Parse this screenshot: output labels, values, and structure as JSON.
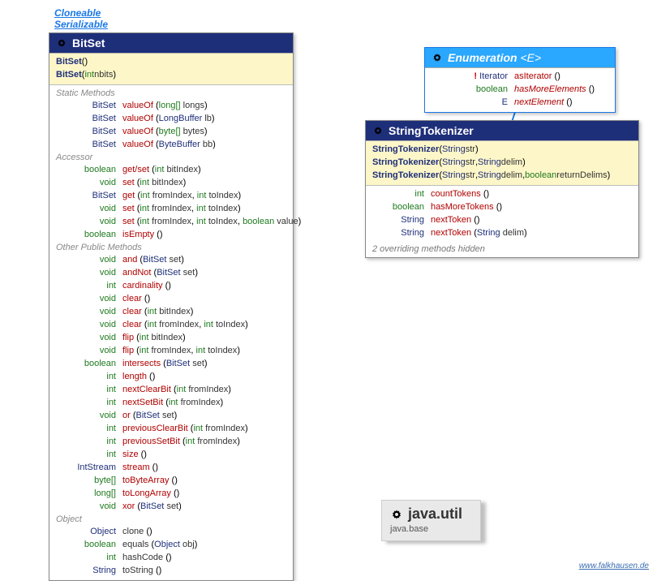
{
  "supertypes": {
    "cloneable": "Cloneable",
    "serializable": "Serializable"
  },
  "bitset": {
    "title": "BitSet",
    "constructors": [
      {
        "name": "BitSet",
        "sig": "()"
      },
      {
        "name": "BitSet",
        "sig": "(",
        "p1type": "int",
        "p1name": "nbits",
        "end": ")"
      }
    ],
    "labels": {
      "static": "Static Methods",
      "accessor": "Accessor",
      "other": "Other Public Methods",
      "object": "Object"
    },
    "static": [
      {
        "ret": "BitSet",
        "name": "valueOf",
        "sig": "(",
        "p": "long[]",
        "pn": "longs",
        "end": ")"
      },
      {
        "ret": "BitSet",
        "name": "valueOf",
        "sig": "(",
        "p": "LongBuffer",
        "pn": "lb",
        "end": ")"
      },
      {
        "ret": "BitSet",
        "name": "valueOf",
        "sig": "(",
        "p": "byte[]",
        "pn": "bytes",
        "end": ")"
      },
      {
        "ret": "BitSet",
        "name": "valueOf",
        "sig": "(",
        "p": "ByteBuffer",
        "pn": "bb",
        "end": ")"
      }
    ],
    "accessor": [
      {
        "ret": "boolean",
        "prim": true,
        "name": "get/set",
        "sig": "(",
        "p": "int",
        "pn": "bitIndex",
        "end": ")"
      },
      {
        "ret": "void",
        "prim": true,
        "name": "set",
        "sig": "(",
        "p": "int",
        "pn": "bitIndex",
        "end": ")"
      },
      {
        "ret": "BitSet",
        "name": "get",
        "sig": "(",
        "two": true,
        "p1": "int",
        "n1": "fromIndex",
        "p2": "int",
        "n2": "toIndex",
        "end": ")"
      },
      {
        "ret": "void",
        "prim": true,
        "name": "set",
        "sig": "(",
        "two": true,
        "p1": "int",
        "n1": "fromIndex",
        "p2": "int",
        "n2": "toIndex",
        "end": ")"
      },
      {
        "ret": "void",
        "prim": true,
        "name": "set",
        "sig": "(",
        "three": true,
        "p1": "int",
        "n1": "fromIndex",
        "p2": "int",
        "n2": "toIndex",
        "p3": "boolean",
        "n3": "value",
        "end": ")"
      },
      {
        "ret": "boolean",
        "prim": true,
        "name": "isEmpty",
        "sig": "()",
        "none": true
      }
    ],
    "other": [
      {
        "ret": "void",
        "prim": true,
        "name": "and",
        "sig": "(",
        "p": "BitSet",
        "pn": "set",
        "end": ")"
      },
      {
        "ret": "void",
        "prim": true,
        "name": "andNot",
        "sig": "(",
        "p": "BitSet",
        "pn": "set",
        "end": ")"
      },
      {
        "ret": "int",
        "prim": true,
        "name": "cardinality",
        "sig": "()",
        "none": true
      },
      {
        "ret": "void",
        "prim": true,
        "name": "clear",
        "sig": "()",
        "none": true
      },
      {
        "ret": "void",
        "prim": true,
        "name": "clear",
        "sig": "(",
        "p": "int",
        "pn": "bitIndex",
        "end": ")"
      },
      {
        "ret": "void",
        "prim": true,
        "name": "clear",
        "sig": "(",
        "two": true,
        "p1": "int",
        "n1": "fromIndex",
        "p2": "int",
        "n2": "toIndex",
        "end": ")"
      },
      {
        "ret": "void",
        "prim": true,
        "name": "flip",
        "sig": "(",
        "p": "int",
        "pn": "bitIndex",
        "end": ")"
      },
      {
        "ret": "void",
        "prim": true,
        "name": "flip",
        "sig": "(",
        "two": true,
        "p1": "int",
        "n1": "fromIndex",
        "p2": "int",
        "n2": "toIndex",
        "end": ")"
      },
      {
        "ret": "boolean",
        "prim": true,
        "name": "intersects",
        "sig": "(",
        "p": "BitSet",
        "pn": "set",
        "end": ")"
      },
      {
        "ret": "int",
        "prim": true,
        "name": "length",
        "sig": "()",
        "none": true
      },
      {
        "ret": "int",
        "prim": true,
        "name": "nextClearBit",
        "sig": "(",
        "p": "int",
        "pn": "fromIndex",
        "end": ")"
      },
      {
        "ret": "int",
        "prim": true,
        "name": "nextSetBit",
        "sig": "(",
        "p": "int",
        "pn": "fromIndex",
        "end": ")"
      },
      {
        "ret": "void",
        "prim": true,
        "name": "or",
        "sig": "(",
        "p": "BitSet",
        "pn": "set",
        "end": ")"
      },
      {
        "ret": "int",
        "prim": true,
        "name": "previousClearBit",
        "sig": "(",
        "p": "int",
        "pn": "fromIndex",
        "end": ")"
      },
      {
        "ret": "int",
        "prim": true,
        "name": "previousSetBit",
        "sig": "(",
        "p": "int",
        "pn": "fromIndex",
        "end": ")"
      },
      {
        "ret": "int",
        "prim": true,
        "name": "size",
        "sig": "()",
        "none": true
      },
      {
        "ret": "IntStream",
        "name": "stream",
        "sig": "()",
        "none": true
      },
      {
        "ret": "byte[]",
        "prim": true,
        "name": "toByteArray",
        "sig": "()",
        "none": true
      },
      {
        "ret": "long[]",
        "prim": true,
        "name": "toLongArray",
        "sig": "()",
        "none": true
      },
      {
        "ret": "void",
        "prim": true,
        "name": "xor",
        "sig": "(",
        "p": "BitSet",
        "pn": "set",
        "end": ")"
      }
    ],
    "object": [
      {
        "ret": "Object",
        "name": "clone",
        "sig": "()",
        "none": true,
        "black": true
      },
      {
        "ret": "boolean",
        "prim": true,
        "name": "equals",
        "sig": "(",
        "p": "Object",
        "pn": "obj",
        "end": ")",
        "black": true
      },
      {
        "ret": "int",
        "prim": true,
        "name": "hashCode",
        "sig": "()",
        "none": true,
        "black": true
      },
      {
        "ret": "String",
        "name": "toString",
        "sig": "()",
        "none": true,
        "black": true
      }
    ]
  },
  "enumeration": {
    "title": "Enumeration",
    "generic": "<E>",
    "rows": [
      {
        "bang": "!",
        "ret": "Iterator<E>",
        "name": "asIterator",
        "sig": "()"
      },
      {
        "ret": "boolean",
        "prim": true,
        "name": "hasMoreElements",
        "italic": true,
        "sig": "()"
      },
      {
        "ret": "E",
        "name": "nextElement",
        "italic": true,
        "sig": "()"
      }
    ]
  },
  "tokenizer": {
    "title": "StringTokenizer",
    "constructors": [
      {
        "name": "StringTokenizer",
        "sig": "(",
        "p": "String",
        "pn": "str",
        "end": ")"
      },
      {
        "name": "StringTokenizer",
        "sig": "(",
        "two": true,
        "p1": "String",
        "n1": "str",
        "p2": "String",
        "n2": "delim",
        "end": ")"
      },
      {
        "name": "StringTokenizer",
        "sig": "(",
        "three": true,
        "p1": "String",
        "n1": "str",
        "p2": "String",
        "n2": "delim",
        "p3": "boolean",
        "n3": "returnDelims",
        "end": ")"
      }
    ],
    "methods": [
      {
        "ret": "int",
        "prim": true,
        "name": "countTokens",
        "sig": "()",
        "none": true
      },
      {
        "ret": "boolean",
        "prim": true,
        "name": "hasMoreTokens",
        "sig": "()",
        "none": true
      },
      {
        "ret": "String",
        "name": "nextToken",
        "sig": "()",
        "none": true
      },
      {
        "ret": "String",
        "name": "nextToken",
        "sig": "(",
        "p": "String",
        "pn": "delim",
        "end": ")"
      }
    ],
    "footer": "2 overriding methods hidden"
  },
  "package": {
    "title": "java.util",
    "subtitle": "java.base"
  },
  "footer_link": "www.falkhausen.de"
}
